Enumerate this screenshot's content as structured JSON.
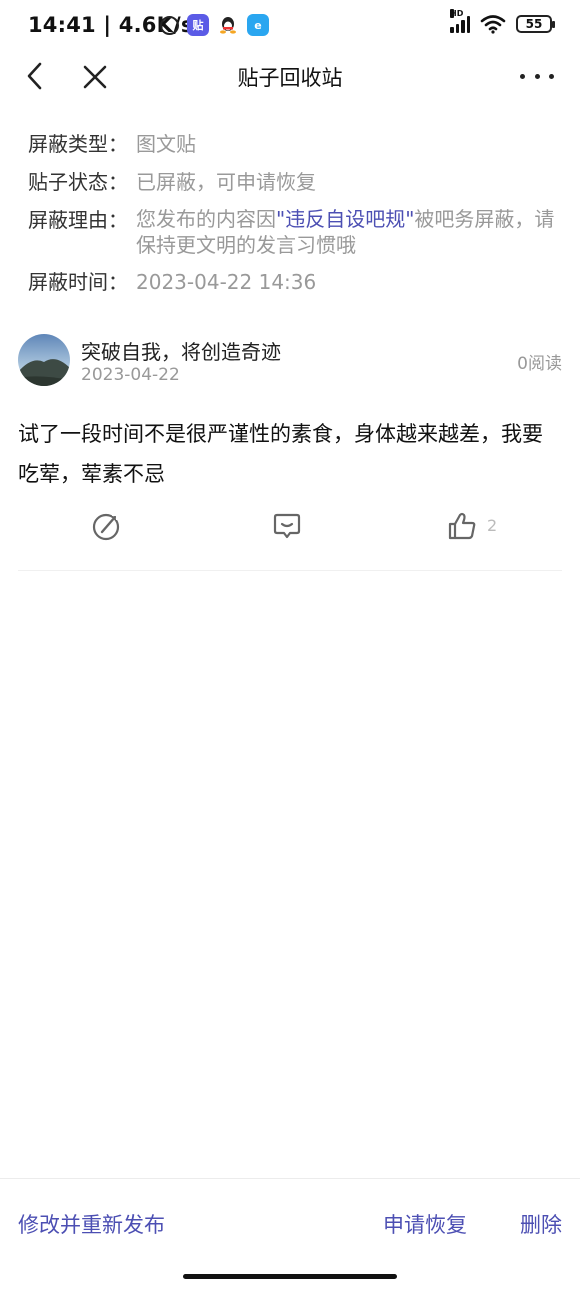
{
  "status_bar": {
    "time": "14:41",
    "network_speed": "4.6K/s",
    "battery": "55",
    "signal_tag": "HD",
    "app_icons": [
      "alarm-icon",
      "tieba-icon",
      "qq-icon",
      "e-icon"
    ]
  },
  "nav": {
    "title": "贴子回收站"
  },
  "info": {
    "type_label": "屏蔽类型：",
    "type_value": "图文贴",
    "status_label": "贴子状态：",
    "status_value": "已屏蔽，可申请恢复",
    "reason_label": "屏蔽理由：",
    "reason_prefix": "您发布的内容因",
    "reason_highlight": "\"违反自设吧规\"",
    "reason_suffix": "被吧务屏蔽，请保持更文明的发言习惯哦",
    "time_label": "屏蔽时间：",
    "time_value": "2023-04-22 14:36"
  },
  "post": {
    "author": "突破自我，将创造奇迹",
    "date": "2023-04-22",
    "read_count": "0阅读",
    "text": "试了一段时间不是很严谨性的素食，身体越来越差，我要吃荤，荤素不忌",
    "like_count": "2"
  },
  "bottom": {
    "edit_label": "修改并重新发布",
    "restore_label": "申请恢复",
    "delete_label": "删除"
  },
  "colors": {
    "accent": "#4c4fb3",
    "muted": "#999999"
  }
}
